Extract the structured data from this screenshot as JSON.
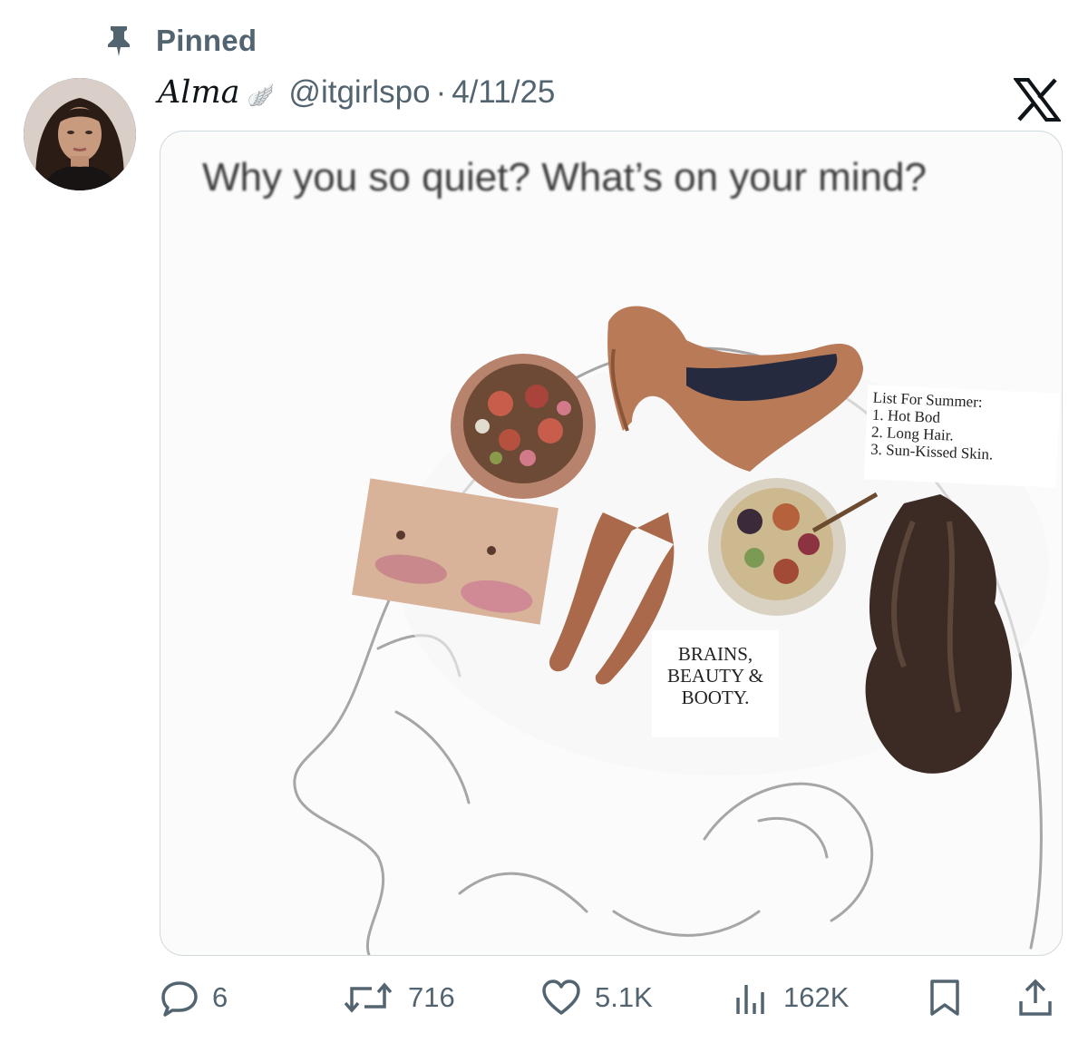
{
  "pinned": {
    "label": "Pinned"
  },
  "post": {
    "display_name": "Alma",
    "name_emoji": "🪽",
    "handle": "@itgirlspo",
    "separator": "·",
    "date": "4/11/25",
    "media": {
      "caption": "Why you so quiet? What’s on your mind?",
      "summer_list": {
        "title": "List For Summer:",
        "items": [
          "1. Hot Bod",
          "2. Long Hair.",
          "3. Sun-Kissed Skin."
        ]
      },
      "brains_text": [
        "BRAINS,",
        "BEAUTY &",
        "BOOTY."
      ]
    }
  },
  "actions": {
    "replies": "6",
    "reposts": "716",
    "likes": "5.1K",
    "views": "162K"
  },
  "icons": [
    "pin-icon",
    "x-logo-icon",
    "reply-icon",
    "repost-icon",
    "like-icon",
    "views-icon",
    "bookmark-icon",
    "share-icon"
  ],
  "colors": {
    "text": "#0f1419",
    "secondary": "#536471",
    "border": "#cfd9de"
  }
}
